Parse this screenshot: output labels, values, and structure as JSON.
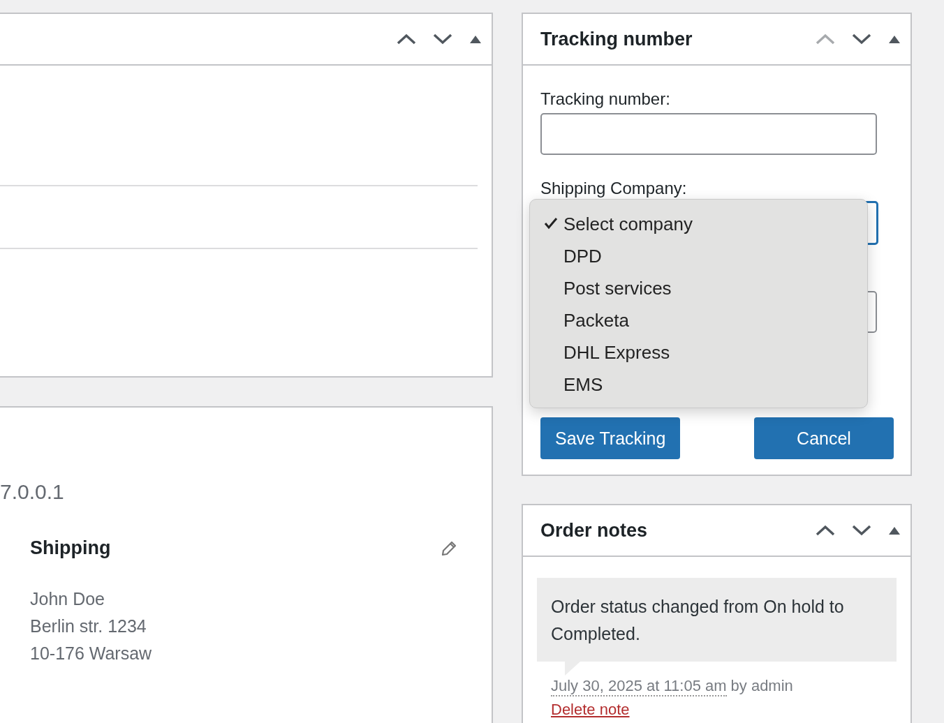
{
  "left_column": {
    "top_panel": {
      "controls": [
        {
          "kind": "move-up",
          "disabled": false
        },
        {
          "kind": "move-down",
          "disabled": false
        },
        {
          "kind": "toggle",
          "expanded": true
        }
      ]
    },
    "details_panel": {
      "ip_address": "7.0.0.1",
      "shipping": {
        "title": "Shipping",
        "address_lines": [
          "John Doe",
          "Berlin str. 1234",
          "10-176 Warsaw"
        ]
      }
    }
  },
  "tracking_panel": {
    "title": "Tracking number",
    "controls": [
      {
        "kind": "move-up",
        "disabled": true
      },
      {
        "kind": "move-down",
        "disabled": false
      },
      {
        "kind": "toggle",
        "expanded": true
      }
    ],
    "tracking_label": "Tracking number:",
    "shipping_label": "Shipping Company:",
    "company_select": {
      "focused": true,
      "open": true,
      "options": [
        {
          "label": "Select company",
          "selected": true
        },
        {
          "label": "DPD",
          "selected": false
        },
        {
          "label": "Post services",
          "selected": false
        },
        {
          "label": "Packeta",
          "selected": false
        },
        {
          "label": "DHL Express",
          "selected": false
        },
        {
          "label": "EMS",
          "selected": false
        }
      ]
    },
    "buttons": [
      "Save Tracking",
      "Cancel"
    ]
  },
  "notes_panel": {
    "title": "Order notes",
    "controls": [
      {
        "kind": "move-up",
        "disabled": false
      },
      {
        "kind": "move-down",
        "disabled": false
      },
      {
        "kind": "toggle",
        "expanded": true
      }
    ],
    "notes": [
      {
        "text": "Order status changed from On hold to Completed.",
        "date": "July 30, 2025 at 11:05 am",
        "author": "by admin",
        "delete_label": "Delete note"
      }
    ]
  }
}
